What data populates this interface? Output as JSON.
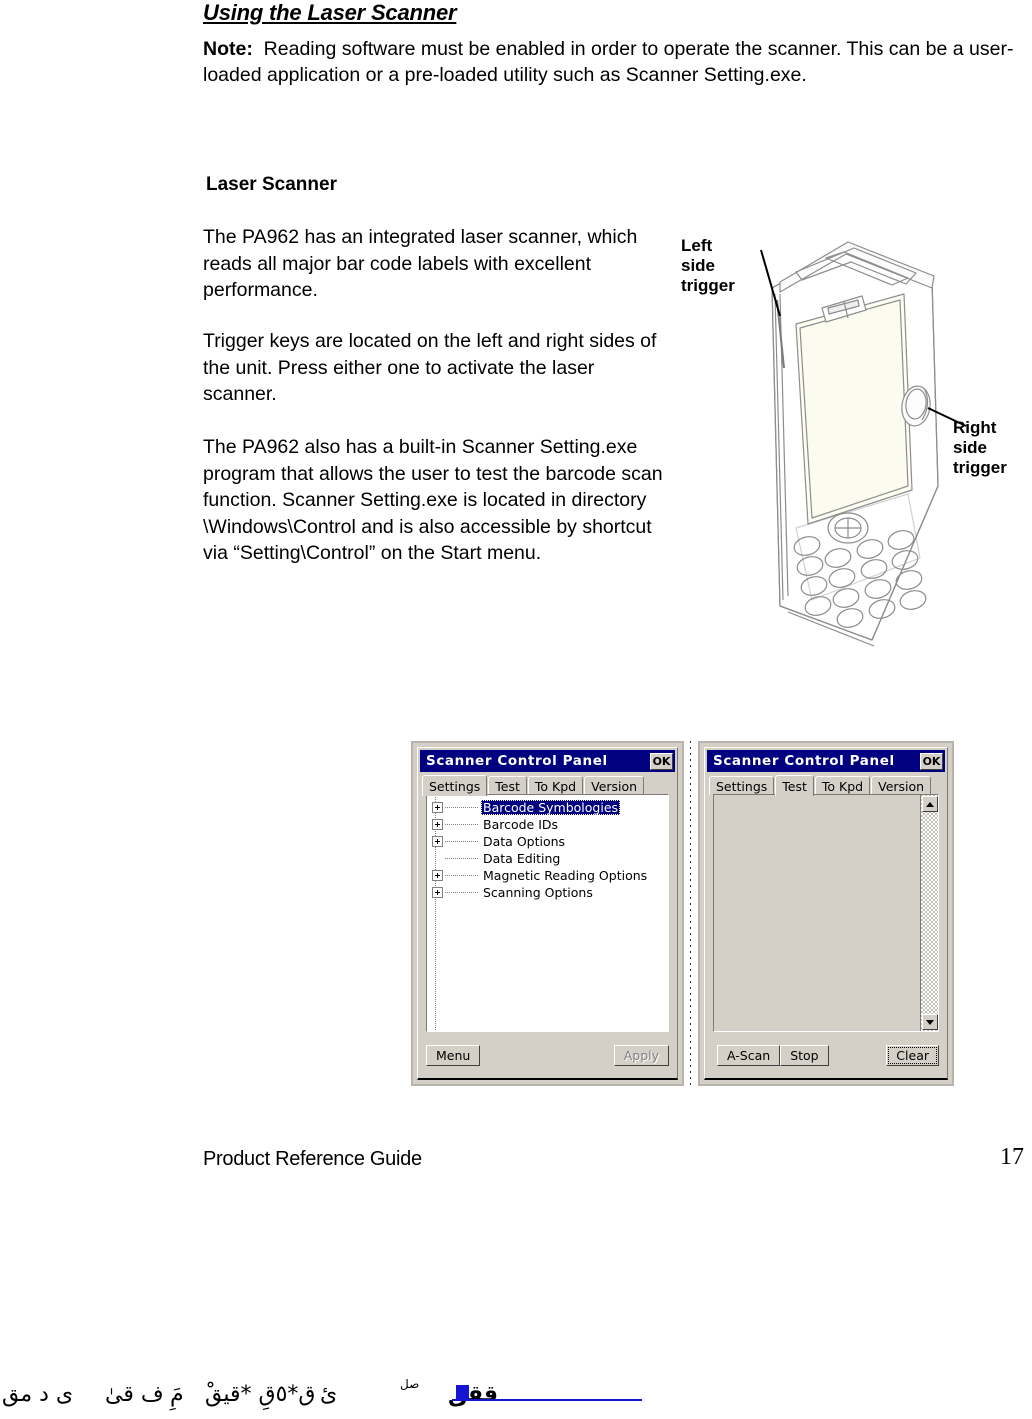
{
  "document": {
    "heading": "Using the Laser Scanner",
    "note_label": "Note:",
    "note_body": "Reading software must be enabled in order to operate the scanner.  This can be a user-loaded application or a pre-loaded utility such as Scanner Setting.exe.",
    "subheading": "Laser Scanner",
    "paragraphs": [
      "The PA962 has an integrated laser scanner, which reads all major bar code labels with excellent performance.",
      "Trigger keys are located on the left and right sides of the unit.  Press either one to activate the laser scanner.",
      "The PA962 also has a built-in Scanner Setting.exe program that allows the user to test the barcode scan function. Scanner Setting.exe is located in directory \\Windows\\Control and is also accessible by shortcut via “Setting\\Control” on the Start menu."
    ]
  },
  "figure": {
    "callout_left": "Left\nside\ntrigger",
    "callout_right": "Right\nside\ntrigger"
  },
  "screenshots": [
    {
      "title": "Scanner Control Panel",
      "ok_label": "OK",
      "tabs": [
        {
          "label": "Settings",
          "active": true
        },
        {
          "label": "Test",
          "active": false
        },
        {
          "label": "To Kpd",
          "active": false
        },
        {
          "label": "Version",
          "active": false
        }
      ],
      "tree": [
        {
          "label": "Barcode Symbologies",
          "expandable": true,
          "selected": true
        },
        {
          "label": "Barcode IDs",
          "expandable": true,
          "selected": false
        },
        {
          "label": "Data Options",
          "expandable": true,
          "selected": false
        },
        {
          "label": "Data Editing",
          "expandable": false,
          "selected": false
        },
        {
          "label": "Magnetic Reading Options",
          "expandable": true,
          "selected": false
        },
        {
          "label": "Scanning Options",
          "expandable": true,
          "selected": false
        }
      ],
      "buttons": [
        {
          "label": "Menu",
          "state": "normal"
        },
        {
          "label": "Apply",
          "state": "disabled"
        }
      ]
    },
    {
      "title": "Scanner Control Panel",
      "ok_label": "OK",
      "tabs": [
        {
          "label": "Settings",
          "active": false
        },
        {
          "label": "Test",
          "active": true
        },
        {
          "label": "To Kpd",
          "active": false
        },
        {
          "label": "Version",
          "active": false
        }
      ],
      "content": "",
      "scrollbar": {
        "up_glyph": "scroll-up-arrow",
        "down_glyph": "scroll-down-arrow"
      },
      "buttons": [
        {
          "label": "A-Scan",
          "state": "normal"
        },
        {
          "label": "Stop",
          "state": "normal"
        },
        {
          "label": "Clear",
          "state": "focused"
        }
      ]
    }
  ],
  "footer": {
    "text": "Product Reference Guide",
    "page_number": "17"
  },
  "artifact": {
    "glyphs": [
      "ى د مق",
      "ف  قیٰ",
      "مَِ",
      "ْق*٥قِ *قیق",
      "ئ",
      "صل",
      "ققق"
    ]
  },
  "colors": {
    "titlebar": "#000080",
    "window_face": "#d4d0c8",
    "selection": "#000080",
    "link": "#1414d2"
  }
}
